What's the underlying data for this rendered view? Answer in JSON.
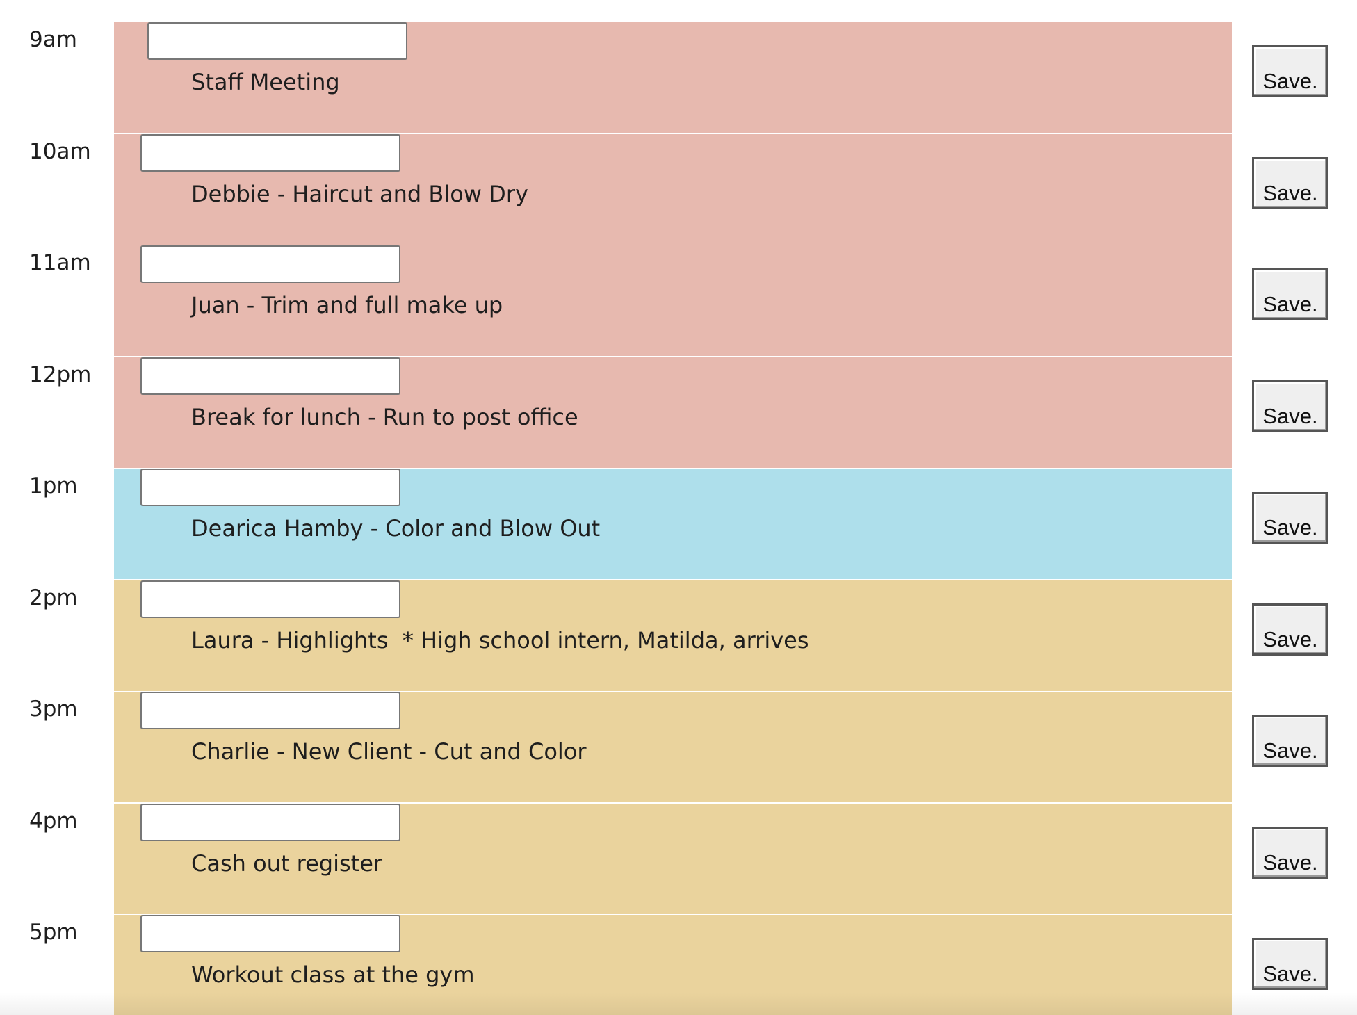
{
  "save_label": "Save.",
  "colors": {
    "past": "#e7b9af",
    "present": "#aedfeb",
    "future": "#ead39d"
  },
  "hours": [
    {
      "label": "9am",
      "event": "Staff Meeting",
      "state": "past",
      "input_value": ""
    },
    {
      "label": "10am",
      "event": "Debbie - Haircut and Blow Dry",
      "state": "past",
      "input_value": ""
    },
    {
      "label": "11am",
      "event": "Juan - Trim and full make up",
      "state": "past",
      "input_value": ""
    },
    {
      "label": "12pm",
      "event": "Break for lunch - Run to post office",
      "state": "past",
      "input_value": ""
    },
    {
      "label": "1pm",
      "event": "Dearica Hamby - Color and Blow Out",
      "state": "present",
      "input_value": ""
    },
    {
      "label": "2pm",
      "event": "Laura - Highlights  * High school intern, Matilda, arrives",
      "state": "future",
      "input_value": ""
    },
    {
      "label": "3pm",
      "event": "Charlie - New Client - Cut and Color",
      "state": "future",
      "input_value": ""
    },
    {
      "label": "4pm",
      "event": "Cash out register",
      "state": "future",
      "input_value": ""
    },
    {
      "label": "5pm",
      "event": "Workout class at the gym",
      "state": "future",
      "input_value": ""
    }
  ]
}
